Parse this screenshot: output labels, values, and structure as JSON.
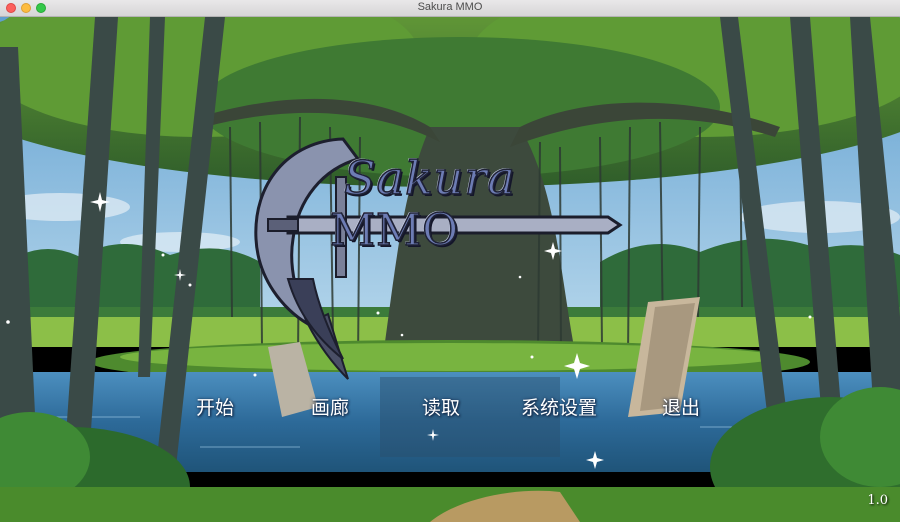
{
  "window": {
    "title": "Sakura MMO"
  },
  "logo": {
    "line1": "Sakura",
    "line2": "MMO"
  },
  "menu": {
    "start": "开始",
    "gallery": "画廊",
    "load": "读取",
    "settings": "系统设置",
    "exit": "退出"
  },
  "version": "1.0",
  "colors": {
    "menu_text": "#ffffff",
    "logo_fill": "#6d7cb4",
    "water": "#2f6f9e",
    "foliage": "#4f8a2a"
  }
}
